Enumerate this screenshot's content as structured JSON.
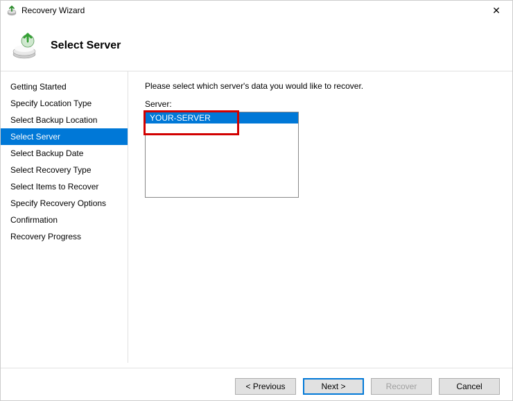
{
  "window": {
    "title": "Recovery Wizard"
  },
  "header": {
    "title": "Select Server"
  },
  "sidebar": {
    "steps": [
      {
        "label": "Getting Started"
      },
      {
        "label": "Specify Location Type"
      },
      {
        "label": "Select Backup Location"
      },
      {
        "label": "Select Server"
      },
      {
        "label": "Select Backup Date"
      },
      {
        "label": "Select Recovery Type"
      },
      {
        "label": "Select Items to Recover"
      },
      {
        "label": "Specify Recovery Options"
      },
      {
        "label": "Confirmation"
      },
      {
        "label": "Recovery Progress"
      }
    ],
    "activeIndex": 3
  },
  "main": {
    "instruction": "Please select which server's data you would like to recover.",
    "serverLabel": "Server:",
    "servers": [
      {
        "name": "YOUR-SERVER"
      }
    ],
    "selectedServerIndex": 0
  },
  "footer": {
    "previous": "< Previous",
    "next": "Next >",
    "recover": "Recover",
    "cancel": "Cancel"
  }
}
